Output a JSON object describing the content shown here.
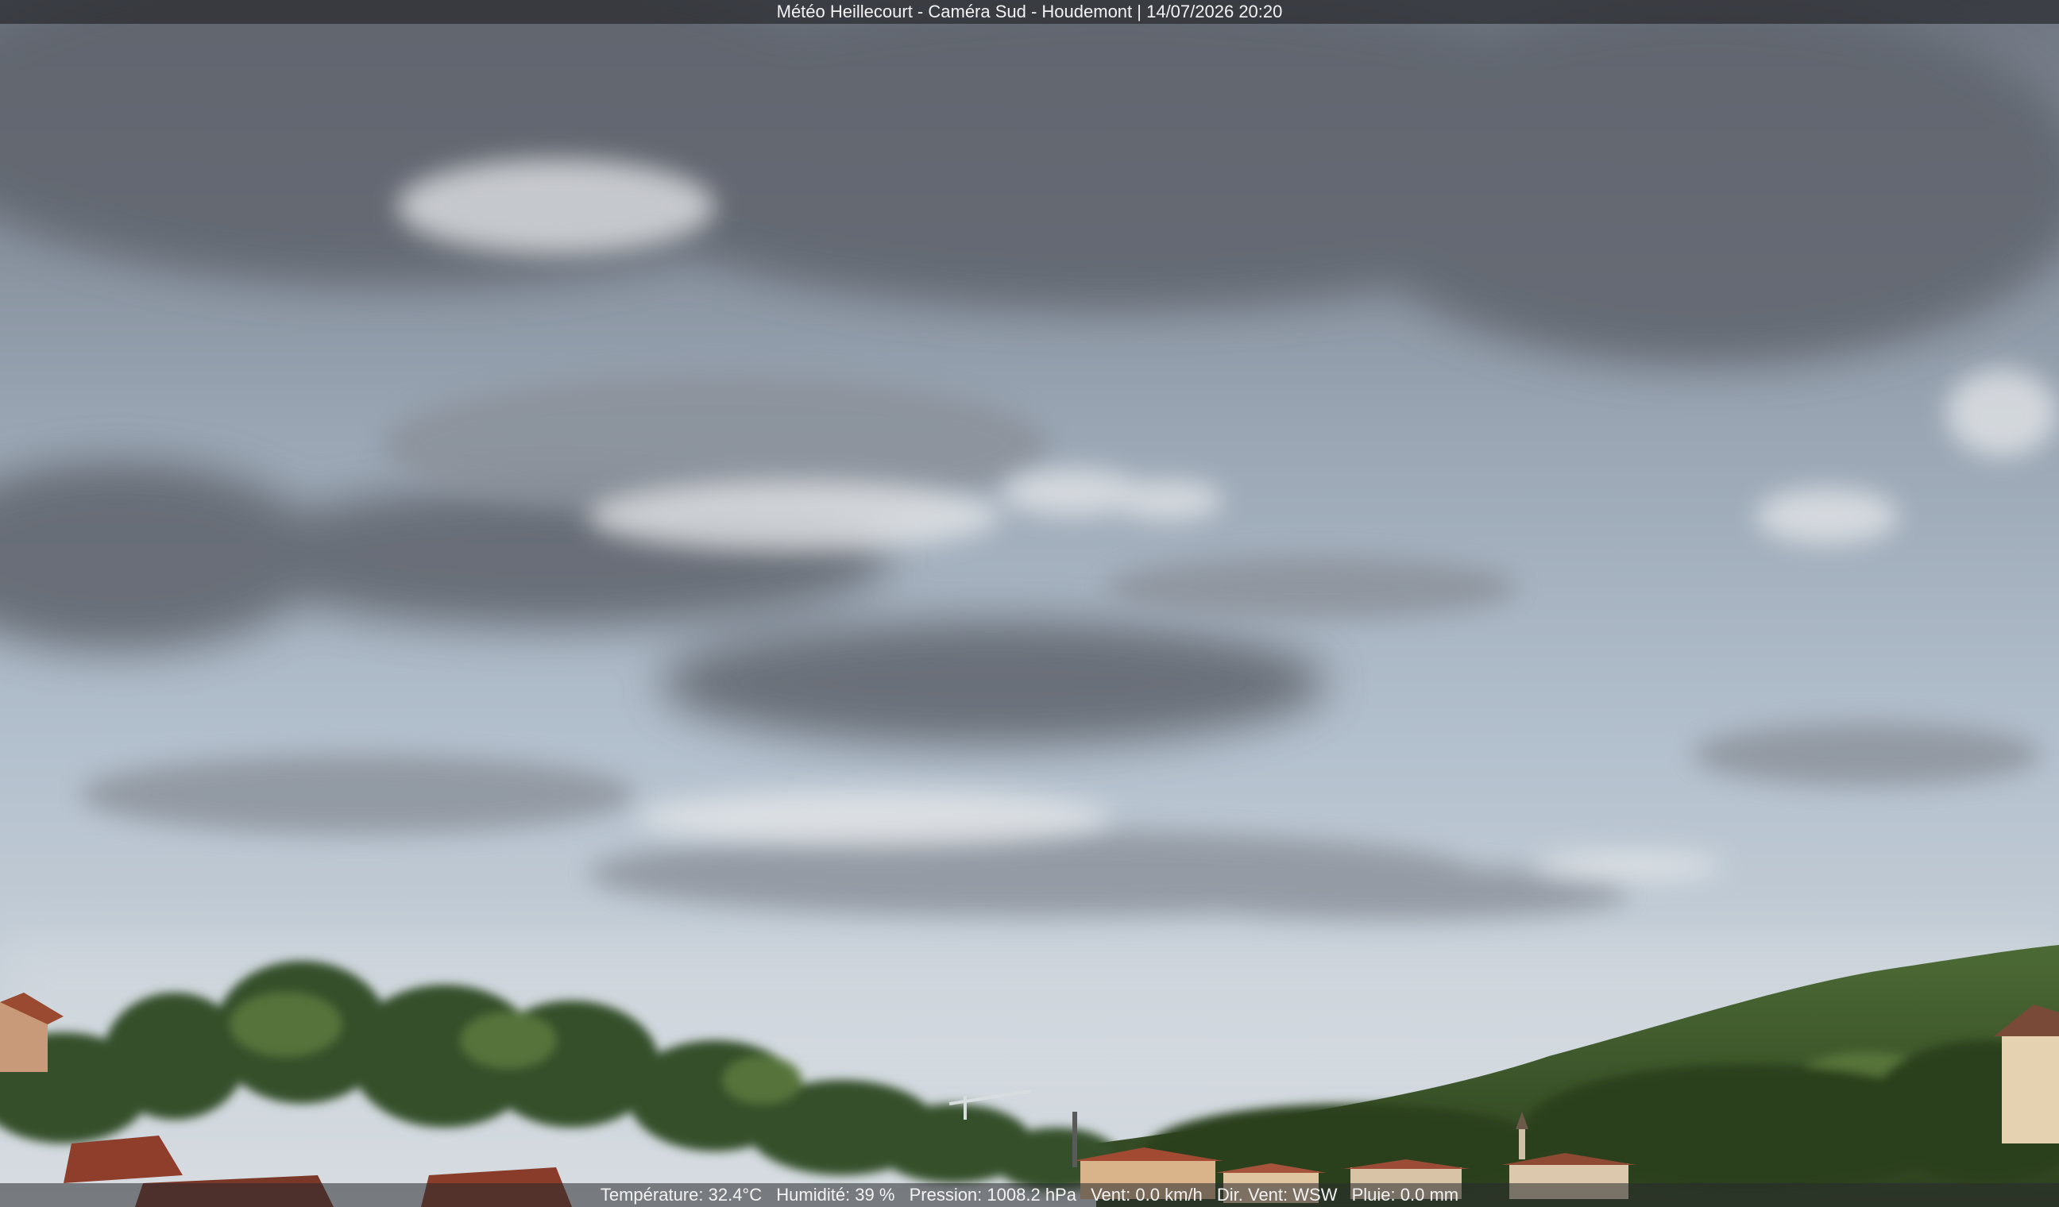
{
  "header": {
    "caption": "Météo Heillecourt - Caméra Sud - Houdemont | 14/07/2026 20:20"
  },
  "footer": {
    "items": [
      {
        "label": "Température:",
        "value": "32.4°C"
      },
      {
        "label": "Humidité:",
        "value": "39 %"
      },
      {
        "label": "Pression:",
        "value": "1008.2 hPa"
      },
      {
        "label": "Vent:",
        "value": "0.0 km/h"
      },
      {
        "label": "Dir. Vent:",
        "value": "WSW"
      },
      {
        "label": "Pluie:",
        "value": "0.0 mm"
      }
    ]
  },
  "colors": {
    "sky_top": "#6f7681",
    "sky_mid": "#a9b7c6",
    "sky_low": "#cdd6de",
    "cloud_dark": "#5f646c",
    "cloud_light": "#e6e8ea",
    "vegetation": "#3f5a2c",
    "roof": "#9a4a30"
  }
}
